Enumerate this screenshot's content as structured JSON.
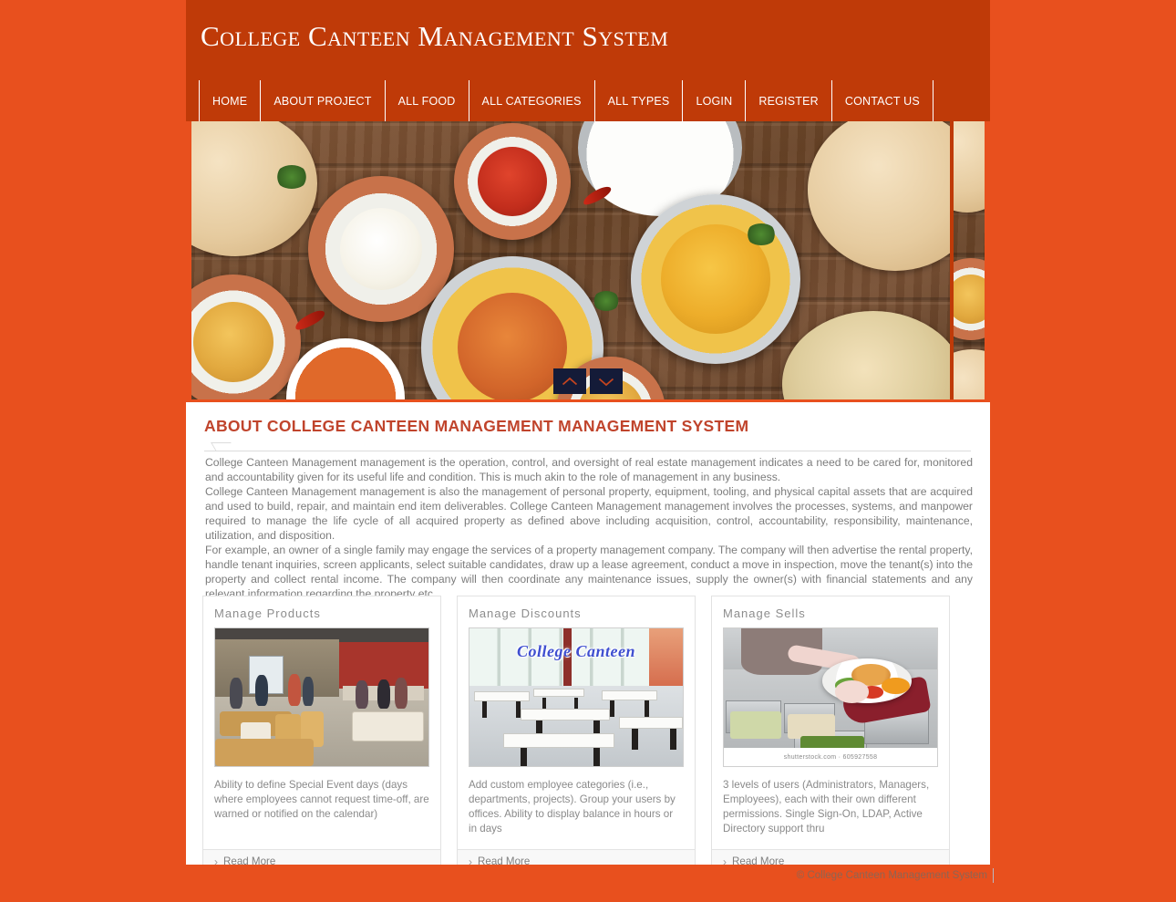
{
  "header": {
    "title": "College Canteen Management System"
  },
  "nav": {
    "items": [
      {
        "label": "HOME"
      },
      {
        "label": "ABOUT PROJECT"
      },
      {
        "label": "ALL FOOD"
      },
      {
        "label": "ALL CATEGORIES"
      },
      {
        "label": "ALL TYPES"
      },
      {
        "label": "LOGIN"
      },
      {
        "label": "REGISTER"
      },
      {
        "label": "CONTACT US"
      }
    ]
  },
  "slider": {
    "prev_icon": "chevron-up-icon",
    "next_icon": "chevron-down-icon"
  },
  "about": {
    "heading": "ABOUT COLLEGE CANTEEN MANAGEMENT MANAGEMENT SYSTEM",
    "paragraphs": [
      "College Canteen Management management is the operation, control, and oversight of real estate management indicates a need to be cared for, monitored and accountability given for its useful life and condition. This is much akin to the role of management in any business.",
      "College Canteen Management management is also the management of personal property, equipment, tooling, and physical capital assets that are acquired and used to build, repair, and maintain end item deliverables. College Canteen Management management involves the processes, systems, and manpower required to manage the life cycle of all acquired property as defined above including acquisition, control, accountability, responsibility, maintenance, utilization, and disposition.",
      "For example, an owner of a single family may engage the services of a property management company. The company will then advertise the rental property, handle tenant inquiries, screen applicants, select suitable candidates, draw up a lease agreement, conduct a move in inspection, move the tenant(s) into the property and collect rental income. The company will then coordinate any maintenance issues, supply the owner(s) with financial statements and any relevant information regarding the property etc."
    ]
  },
  "cards": [
    {
      "title": "Manage Products",
      "text": "Ability to define Special Event days (days where employees cannot request time-off, are warned or notified on the calendar)",
      "more_label": "Read More",
      "more_icon": "chevron-right-icon",
      "image_alt": "college canteen interior with students seated at wooden tables"
    },
    {
      "title": "Manage Discounts",
      "text": "Add custom employee categories (i.e., departments, projects). Group your users by offices. Ability to display balance in hours or in days",
      "more_label": "Read More",
      "more_icon": "chevron-right-icon",
      "image_alt": "empty cafeteria hall with white benches",
      "image_caption": "College Canteen"
    },
    {
      "title": "Manage Sells",
      "text": "3 levels of users (Administrators, Managers, Employees), each with their own different permissions. Single Sign-On, LDAP, Active Directory support thru",
      "more_label": "Read More",
      "more_icon": "chevron-right-icon",
      "image_alt": "canteen staff serving a plate of food over the counter",
      "watermark": "shutterstock.com · 605927558"
    }
  ],
  "footer": {
    "copyright": "© College Canteen Management System"
  },
  "colors": {
    "page_background": "#e8501e",
    "header_background": "#bf3a08",
    "heading_accent": "#c0442c",
    "body_text": "#7c7c7c",
    "card_title": "#8d8d8d",
    "slider_button": "#141b38"
  }
}
